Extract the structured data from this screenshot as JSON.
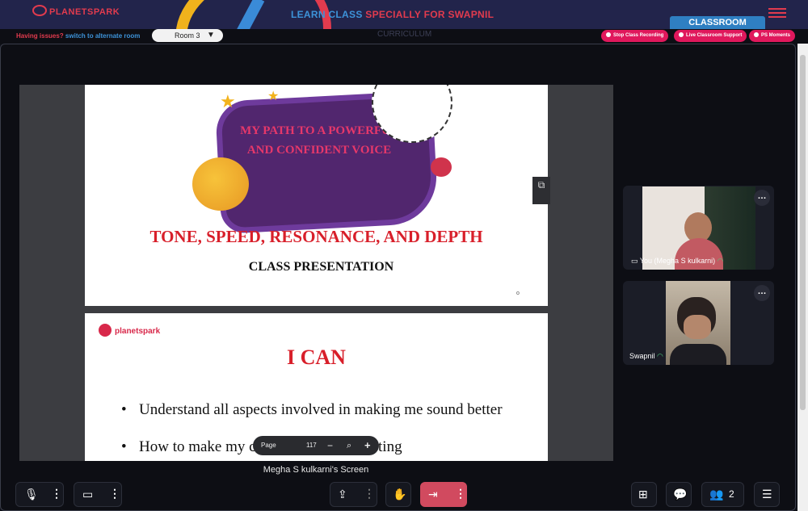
{
  "header": {
    "logo": "PLANETSPARK",
    "title_part1": "LEARN CLASS",
    "title_part2": "SPECIALLY FOR SWAPNIL",
    "tab": "CLASSROOM",
    "sub_tab": "CURRICULUM"
  },
  "issues": {
    "text": "Having issues?",
    "link": "switch to alternate room"
  },
  "room_select": {
    "value": "Room 3"
  },
  "actions": {
    "stop_recording": "Stop Class Recording",
    "live_support": "Live Classroom Support",
    "ps_moments": "PS Moments"
  },
  "slide1": {
    "panel_text": "MY PATH TO A POWERFUL AND CONFIDENT VOICE",
    "heading": "TONE, SPEED, RESONANCE, AND DEPTH",
    "subheading": "CLASS PRESENTATION",
    "marker": "o"
  },
  "slide2": {
    "logo": "planetspark",
    "heading": "I CAN",
    "bullets": [
      "Understand all aspects involved in making me sound better",
      "How to make my conversations interesting"
    ]
  },
  "pdf_toolbar": {
    "page_label": "Page",
    "page_total": "117"
  },
  "screen_caption": "Megha S kulkarni's Screen",
  "participants": [
    {
      "name": "You (Megha S kulkarni)"
    },
    {
      "name": "Swapnil"
    }
  ],
  "controls": {
    "participant_count": "2"
  },
  "colors": {
    "brand_red": "#e23b4e",
    "brand_blue": "#3d93d9",
    "header_bg": "#22244b",
    "leave_red": "#d14a5f"
  }
}
